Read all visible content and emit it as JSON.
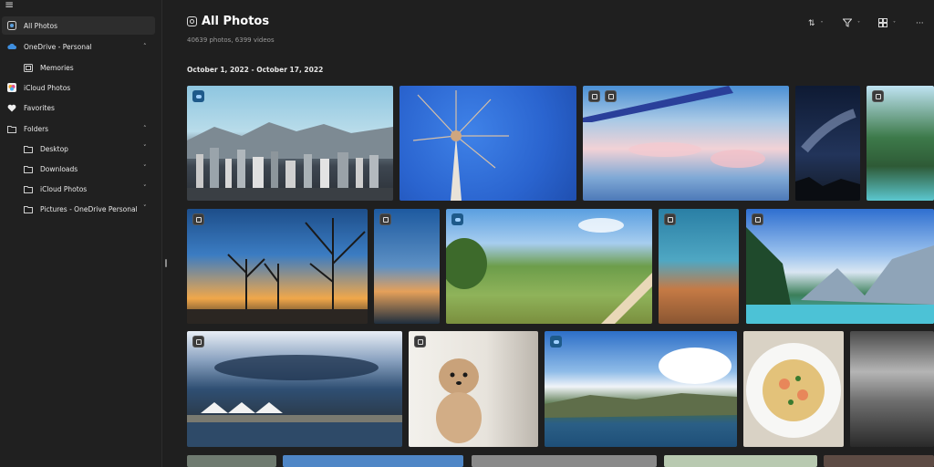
{
  "sidebar": {
    "items": [
      {
        "label": "All Photos",
        "icon": "photos-icon"
      },
      {
        "label": "OneDrive - Personal",
        "icon": "cloud-icon"
      },
      {
        "label": "Memories",
        "icon": "memories-icon"
      },
      {
        "label": "iCloud Photos",
        "icon": "icloud-icon"
      },
      {
        "label": "Favorites",
        "icon": "heart-icon"
      },
      {
        "label": "Folders",
        "icon": "folder-icon"
      },
      {
        "label": "Desktop",
        "icon": "folder-icon"
      },
      {
        "label": "Downloads",
        "icon": "folder-icon"
      },
      {
        "label": "iCloud Photos",
        "icon": "folder-icon"
      },
      {
        "label": "Pictures - OneDrive Personal",
        "icon": "folder-icon"
      }
    ]
  },
  "header": {
    "title": "All Photos",
    "subtitle": "40639 photos, 6399 videos",
    "date_range": "October 1, 2022 - October 17, 2022"
  },
  "toolbar": {
    "sort_icon": "sort-icon",
    "filter_icon": "filter-icon",
    "view_icon": "view-icon",
    "more_icon": "more-icon"
  },
  "colors": {
    "background": "#1f1f1f",
    "sidebar": "#202020",
    "selected": "#2d2d2d",
    "cloud_badge": "#1e5a8a"
  }
}
